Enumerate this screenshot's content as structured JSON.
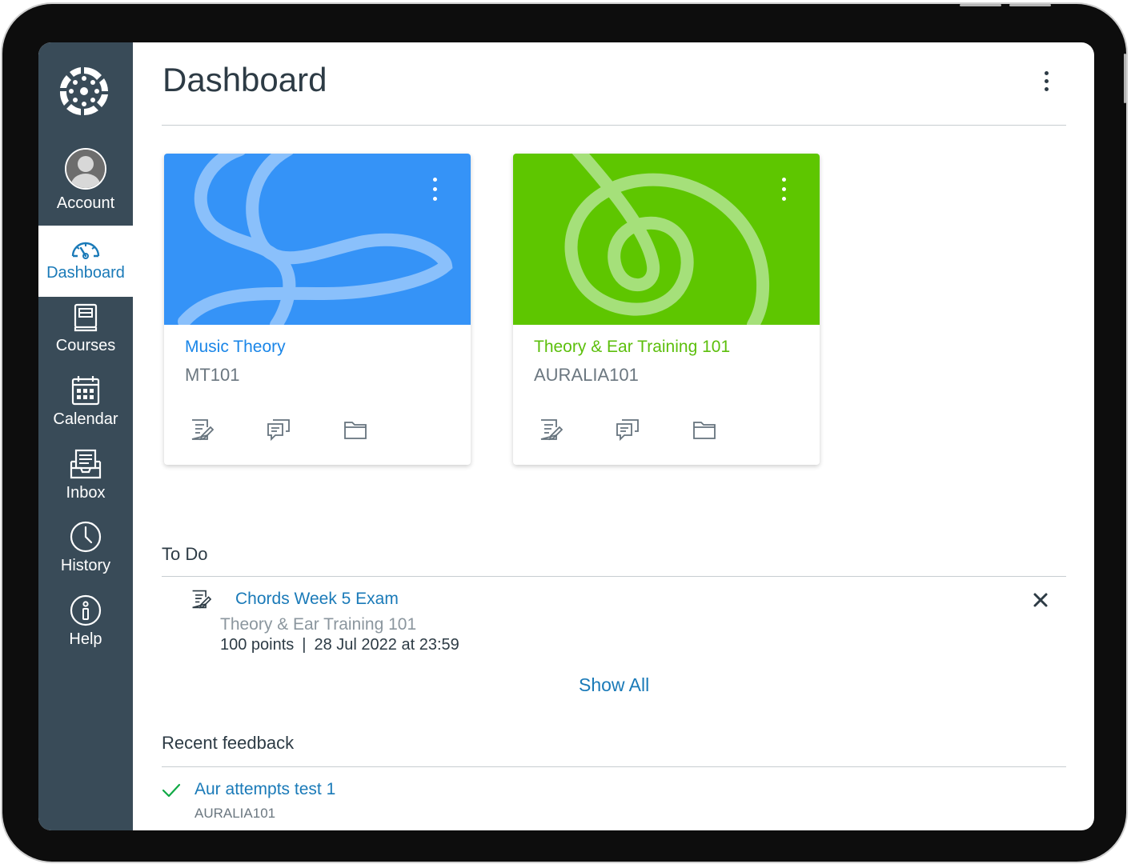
{
  "sidebar": {
    "logo": "canvas-logo",
    "items": [
      {
        "label": "Account",
        "icon": "avatar-icon"
      },
      {
        "label": "Dashboard",
        "icon": "dashboard-gauge-icon"
      },
      {
        "label": "Courses",
        "icon": "courses-book-icon"
      },
      {
        "label": "Calendar",
        "icon": "calendar-icon"
      },
      {
        "label": "Inbox",
        "icon": "inbox-icon"
      },
      {
        "label": "History",
        "icon": "clock-icon"
      },
      {
        "label": "Help",
        "icon": "info-icon"
      }
    ]
  },
  "header": {
    "title": "Dashboard",
    "menu_icon": "kebab-icon"
  },
  "cards": [
    {
      "title": "Music Theory",
      "code": "MT101",
      "color": "#3593f7",
      "title_color": "#1a86e8",
      "actions": [
        "assignments-icon",
        "discussions-icon",
        "files-icon"
      ]
    },
    {
      "title": "Theory & Ear Training 101",
      "code": "AURALIA101",
      "color": "#5ec600",
      "title_color": "#5cbf0c",
      "actions": [
        "assignments-icon",
        "discussions-icon",
        "files-icon"
      ]
    }
  ],
  "todo": {
    "heading": "To Do",
    "items": [
      {
        "title": "Chords Week 5 Exam",
        "course": "Theory & Ear Training 101",
        "points": "100 points",
        "separator": "|",
        "due": "28 Jul 2022 at 23:59"
      }
    ],
    "show_all": "Show All"
  },
  "feedback": {
    "heading": "Recent feedback",
    "items": [
      {
        "title": "Aur attempts test 1",
        "course": "AURALIA101"
      }
    ]
  },
  "colors": {
    "sidebar": "#394b58",
    "link": "#1a7ab8",
    "text": "#2d3b45"
  }
}
